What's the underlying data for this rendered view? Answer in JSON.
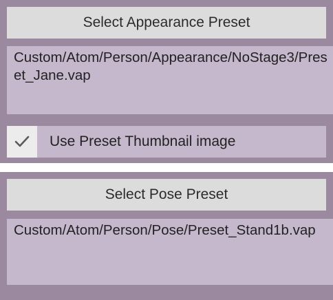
{
  "appearance": {
    "button_label": "Select Appearance Preset",
    "path_text": "Custom/Atom/Person/Appearance/NoStage3/Preset_Jane.vap",
    "thumbnail_toggle": {
      "label": "Use Preset Thumbnail image",
      "checked": true
    }
  },
  "pose": {
    "button_label": "Select Pose Preset",
    "path_text": "Custom/Atom/Person/Pose/Preset_Stand1b.vap"
  },
  "colors": {
    "panel_background": "#9b89a0",
    "field_background": "#c6b8cc",
    "button_background": "#dcdcdc",
    "checkbox_background": "#ececec",
    "checkmark": "#5a5a5a"
  },
  "icons": {
    "checkbox": "checkmark-icon"
  }
}
